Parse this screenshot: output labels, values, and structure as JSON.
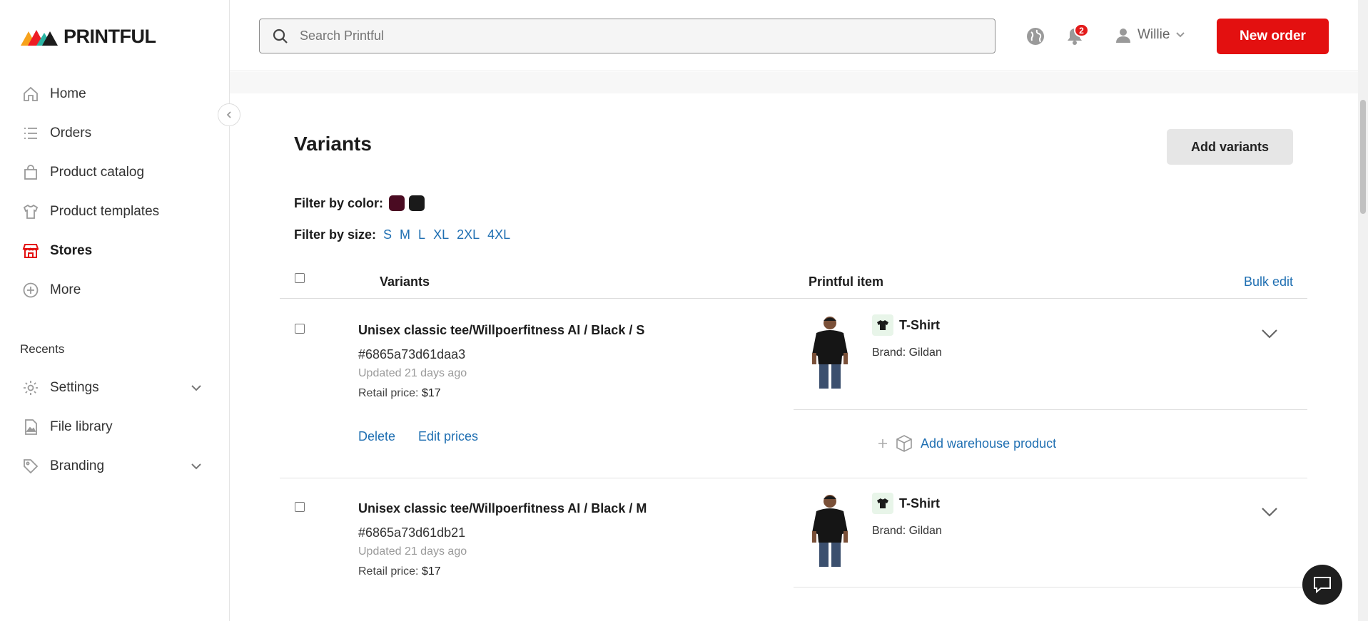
{
  "brand": {
    "logo_text": "PRINTFUL"
  },
  "sidebar": {
    "items": [
      {
        "label": "Home",
        "icon": "home-icon"
      },
      {
        "label": "Orders",
        "icon": "list-icon"
      },
      {
        "label": "Product catalog",
        "icon": "shopping-bag-icon"
      },
      {
        "label": "Product templates",
        "icon": "tshirt-icon"
      },
      {
        "label": "Stores",
        "icon": "store-icon"
      },
      {
        "label": "More",
        "icon": "plus-circle-icon"
      }
    ],
    "recents_label": "Recents",
    "recents": [
      {
        "label": "Settings",
        "icon": "gear-icon"
      },
      {
        "label": "File library",
        "icon": "file-image-icon"
      },
      {
        "label": "Branding",
        "icon": "tag-icon"
      }
    ]
  },
  "topbar": {
    "search_placeholder": "Search Printful",
    "notifications_count": "2",
    "user_name": "Willie",
    "new_order_label": "New order"
  },
  "main": {
    "title": "Variants",
    "add_variants_label": "Add variants",
    "filter_color_label": "Filter by color:",
    "colors": [
      "#4a0b22",
      "#1a1a1a"
    ],
    "filter_size_label": "Filter by size:",
    "sizes": [
      "S",
      "M",
      "L",
      "XL",
      "2XL",
      "4XL"
    ],
    "col_variants": "Variants",
    "col_printful_item": "Printful item",
    "bulk_edit": "Bulk edit",
    "rows": [
      {
        "name": "Unisex classic tee/Willpoerfitness AI / Black / S",
        "sku": "#6865a73d61daa3",
        "updated": "Updated 21 days ago",
        "price_label": "Retail price:",
        "price": "$17",
        "delete": "Delete",
        "edit_prices": "Edit prices",
        "item_name": "T-Shirt",
        "brand": "Brand: Gildan",
        "add_warehouse": "Add warehouse product"
      },
      {
        "name": "Unisex classic tee/Willpoerfitness AI / Black / M",
        "sku": "#6865a73d61db21",
        "updated": "Updated 21 days ago",
        "price_label": "Retail price:",
        "price": "$17",
        "item_name": "T-Shirt",
        "brand": "Brand: Gildan"
      }
    ]
  },
  "colors": {
    "accent_red": "#e31010",
    "link_blue": "#1f6fb2"
  }
}
